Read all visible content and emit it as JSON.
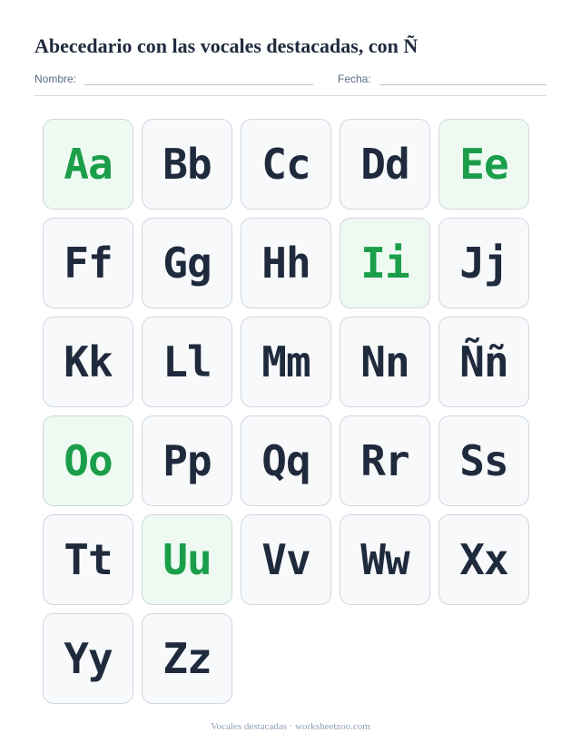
{
  "header": {
    "title": "Abecedario con las vocales destacadas, con Ñ",
    "name_label": "Nombre:",
    "date_label": "Fecha:"
  },
  "letters": [
    {
      "text": "Aa",
      "vowel": true
    },
    {
      "text": "Bb",
      "vowel": false
    },
    {
      "text": "Cc",
      "vowel": false
    },
    {
      "text": "Dd",
      "vowel": false
    },
    {
      "text": "Ee",
      "vowel": true
    },
    {
      "text": "Ff",
      "vowel": false
    },
    {
      "text": "Gg",
      "vowel": false
    },
    {
      "text": "Hh",
      "vowel": false
    },
    {
      "text": "Ii",
      "vowel": true
    },
    {
      "text": "Jj",
      "vowel": false
    },
    {
      "text": "Kk",
      "vowel": false
    },
    {
      "text": "Ll",
      "vowel": false
    },
    {
      "text": "Mm",
      "vowel": false
    },
    {
      "text": "Nn",
      "vowel": false
    },
    {
      "text": "Ññ",
      "vowel": false
    },
    {
      "text": "Oo",
      "vowel": true
    },
    {
      "text": "Pp",
      "vowel": false
    },
    {
      "text": "Qq",
      "vowel": false
    },
    {
      "text": "Rr",
      "vowel": false
    },
    {
      "text": "Ss",
      "vowel": false
    },
    {
      "text": "Tt",
      "vowel": false
    },
    {
      "text": "Uu",
      "vowel": true
    },
    {
      "text": "Vv",
      "vowel": false
    },
    {
      "text": "Ww",
      "vowel": false
    },
    {
      "text": "Xx",
      "vowel": false
    },
    {
      "text": "Yy",
      "vowel": false
    },
    {
      "text": "Zz",
      "vowel": false
    }
  ],
  "colors": {
    "vowel_text": "#1a9e4a",
    "vowel_background": "#eefaf1",
    "consonant_text": "#1f2a3d",
    "consonant_background": "#f8f9fb"
  },
  "footer": {
    "text": "Vocales destacadas · worksheetzoo.com"
  }
}
